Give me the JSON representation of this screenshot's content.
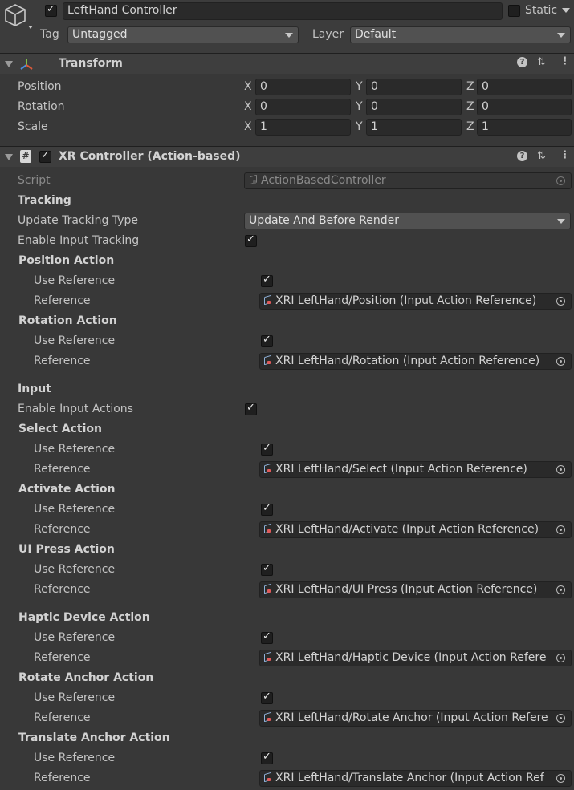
{
  "object": {
    "name": "LeftHand Controller",
    "static_label": "Static",
    "tag_label": "Tag",
    "tag_value": "Untagged",
    "layer_label": "Layer",
    "layer_value": "Default"
  },
  "transform": {
    "title": "Transform",
    "rows": [
      {
        "label": "Position",
        "x": "0",
        "y": "0",
        "z": "0"
      },
      {
        "label": "Rotation",
        "x": "0",
        "y": "0",
        "z": "0"
      },
      {
        "label": "Scale",
        "x": "1",
        "y": "1",
        "z": "1"
      }
    ],
    "axis_x": "X",
    "axis_y": "Y",
    "axis_z": "Z"
  },
  "xr": {
    "title": "XR Controller (Action-based)",
    "script_label": "Script",
    "script_value": "ActionBasedController",
    "tracking_header": "Tracking",
    "update_tracking_label": "Update Tracking Type",
    "update_tracking_value": "Update And Before Render",
    "enable_input_tracking_label": "Enable Input Tracking",
    "input_header": "Input",
    "enable_input_actions_label": "Enable Input Actions",
    "use_reference_label": "Use Reference",
    "reference_label": "Reference",
    "actions": [
      {
        "title": "Position Action",
        "ref": "XRI LeftHand/Position (Input Action Reference)"
      },
      {
        "title": "Rotation Action",
        "ref": "XRI LeftHand/Rotation (Input Action Reference)"
      },
      {
        "title": "Select Action",
        "ref": "XRI LeftHand/Select (Input Action Reference)"
      },
      {
        "title": "Activate Action",
        "ref": "XRI LeftHand/Activate (Input Action Reference)"
      },
      {
        "title": "UI Press Action",
        "ref": "XRI LeftHand/UI Press (Input Action Reference)"
      },
      {
        "title": "Haptic Device Action",
        "ref": "XRI LeftHand/Haptic Device (Input Action Refere"
      },
      {
        "title": "Rotate Anchor Action",
        "ref": "XRI LeftHand/Rotate Anchor (Input Action Refere"
      },
      {
        "title": "Translate Anchor Action",
        "ref": "XRI LeftHand/Translate Anchor (Input Action Ref"
      }
    ]
  }
}
